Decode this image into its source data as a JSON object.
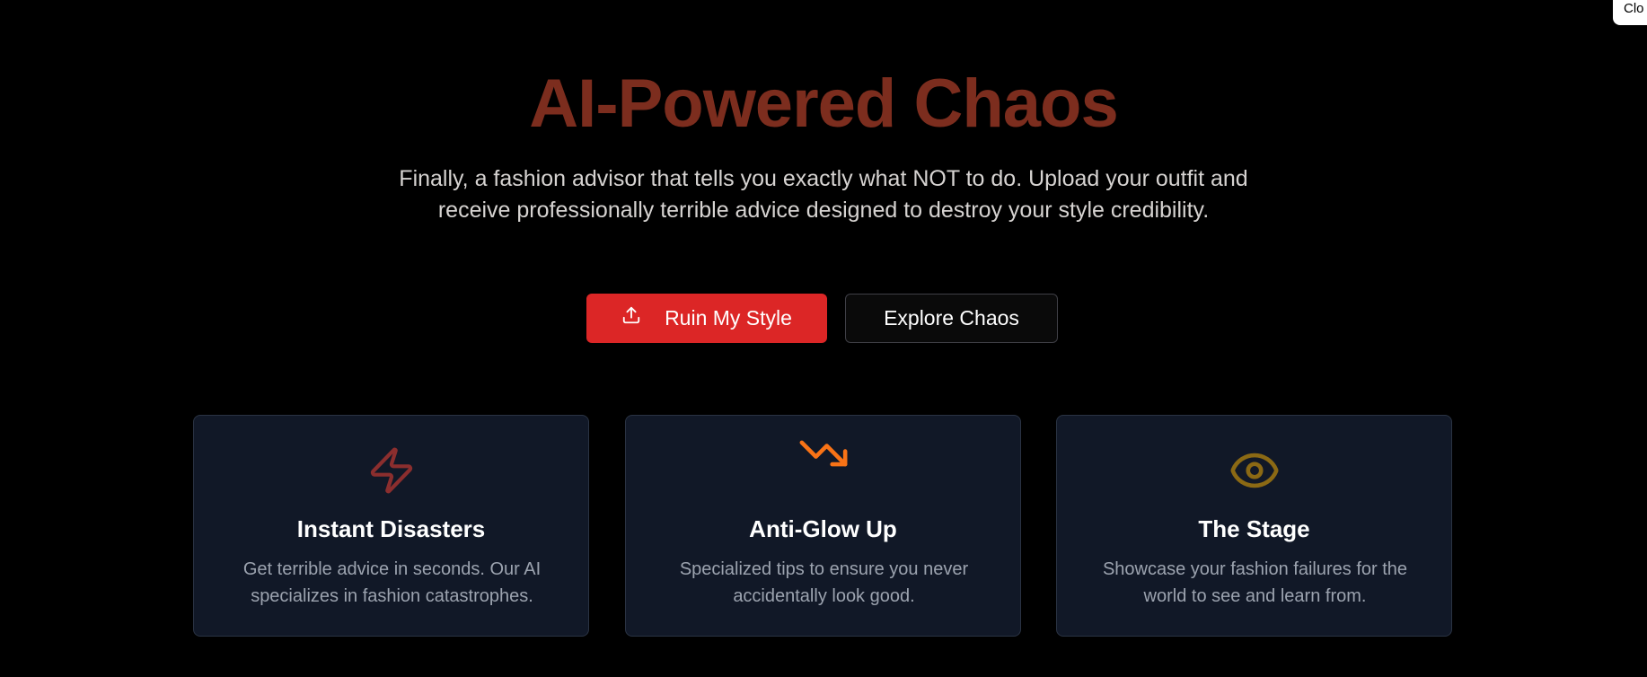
{
  "corner_button": {
    "label": "Clo"
  },
  "hero": {
    "title": "AI-Powered Chaos",
    "subtitle": "Finally, a fashion advisor that tells you exactly what NOT to do. Upload your outfit and receive professionally terrible advice designed to destroy your style credibility.",
    "title_color": "#7c2d1e"
  },
  "actions": {
    "primary": {
      "label": "Ruin My Style",
      "icon": "upload-icon",
      "color": "#dc2626"
    },
    "secondary": {
      "label": "Explore Chaos"
    }
  },
  "features": [
    {
      "icon": "lightning-bolt-icon",
      "icon_color": "#8b2e2e",
      "title": "Instant Disasters",
      "text": "Get terrible advice in seconds. Our AI specializes in fashion catastrophes."
    },
    {
      "icon": "trending-down-icon",
      "icon_color": "#f97316",
      "title": "Anti-Glow Up",
      "text": "Specialized tips to ensure you never accidentally look good."
    },
    {
      "icon": "eye-icon",
      "icon_color": "#8b6914",
      "title": "The Stage",
      "text": "Showcase your fashion failures for the world to see and learn from."
    }
  ]
}
